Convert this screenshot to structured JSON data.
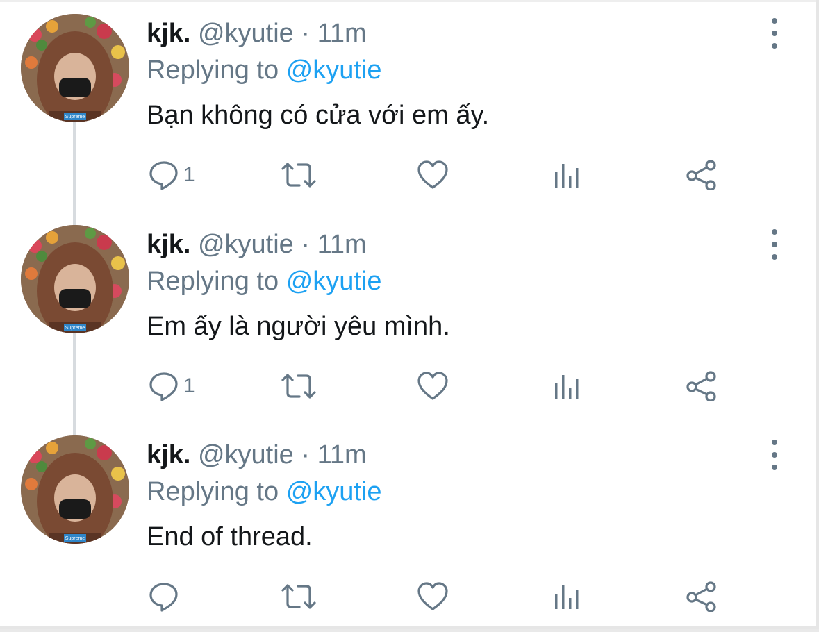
{
  "tweets": [
    {
      "display_name": "kjk.",
      "handle": "@kyutie",
      "separator": "·",
      "time": "11m",
      "replying_prefix": "Replying to",
      "replying_to": "@kyutie",
      "text": "Bạn không có cửa với em ấy.",
      "reply_count": "1",
      "avatar_badge": "Supreme"
    },
    {
      "display_name": "kjk.",
      "handle": "@kyutie",
      "separator": "·",
      "time": "11m",
      "replying_prefix": "Replying to",
      "replying_to": "@kyutie",
      "text": "Em ấy là người yêu mình.",
      "reply_count": "1",
      "avatar_badge": "Supreme"
    },
    {
      "display_name": "kjk.",
      "handle": "@kyutie",
      "separator": "·",
      "time": "11m",
      "replying_prefix": "Replying to",
      "replying_to": "@kyutie",
      "text": "End of thread.",
      "reply_count": "",
      "avatar_badge": "Supreme"
    }
  ],
  "icons": {
    "reply": "reply-bubble-icon",
    "retweet": "retweet-icon",
    "like": "heart-icon",
    "analytics": "bar-chart-icon",
    "share": "share-icon",
    "more": "vertical-ellipsis-icon"
  },
  "colors": {
    "primary_text": "#14171a",
    "secondary_text": "#657786",
    "mention": "#1da1f2",
    "thread_line": "#d7dbdf"
  }
}
